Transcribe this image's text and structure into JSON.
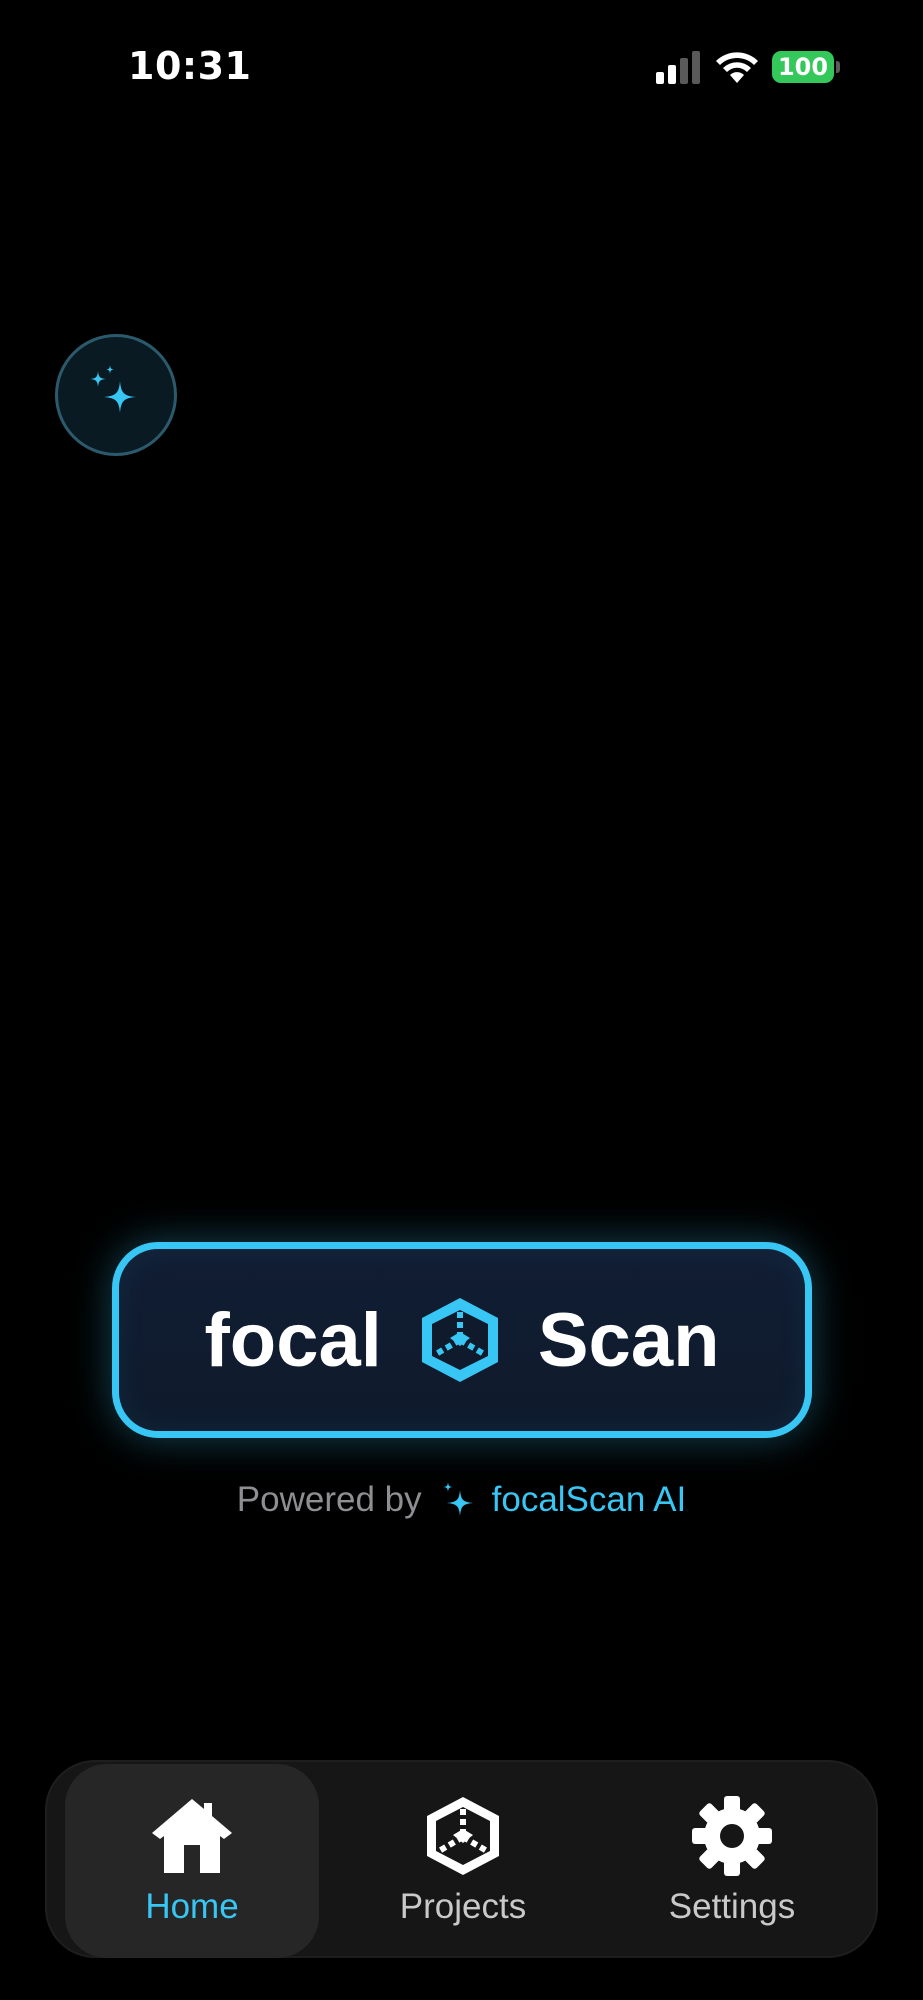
{
  "status_bar": {
    "time": "10:31",
    "battery": "100",
    "icons": [
      "signal-icon",
      "wifi-icon",
      "battery-icon"
    ]
  },
  "ai_button": {
    "icon": "sparkles-icon"
  },
  "logo": {
    "word_left": "focal",
    "word_right": "Scan",
    "icon": "cube-icon"
  },
  "powered": {
    "label": "Powered by",
    "brand": "focalScan AI",
    "icon": "sparkle-icon"
  },
  "tab_bar": {
    "tabs": [
      {
        "label": "Home",
        "icon": "home-icon",
        "selected": true
      },
      {
        "label": "Projects",
        "icon": "cube-icon",
        "selected": false
      },
      {
        "label": "Settings",
        "icon": "gear-icon",
        "selected": false
      }
    ]
  },
  "colors": {
    "accent": "#38c6f4",
    "background": "#000000",
    "tab_bar": "#161616",
    "tab_selected": "#262626",
    "battery": "#34c759",
    "muted_text": "#8e8e93"
  }
}
